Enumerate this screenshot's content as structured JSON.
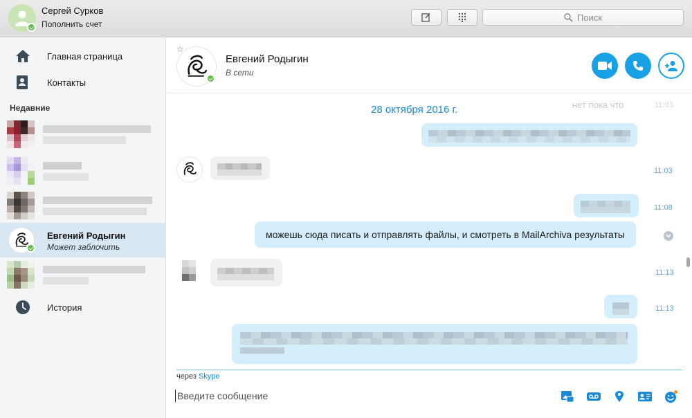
{
  "window": {
    "user_name": "Сергей Сурков",
    "user_action": "Пополнить счет"
  },
  "toolbar": {
    "search_placeholder": "Поиск"
  },
  "sidebar": {
    "nav": [
      {
        "label": "Главная страница",
        "icon": "home-icon"
      },
      {
        "label": "Контакты",
        "icon": "contacts-icon"
      }
    ],
    "recent_title": "Недавние",
    "active_contact": {
      "name": "Евгений Родыгин",
      "status": "Может заблочить"
    },
    "history_label": "История"
  },
  "conversation": {
    "contact_name": "Евгений Родыгин",
    "contact_status": "В сети",
    "date_header": "28 октября 2016 г.",
    "ghost_text": "нет пока что",
    "ghost_time": "11:03",
    "messages": [
      {
        "time": "11:03"
      },
      {
        "time": "11:08"
      },
      {
        "text": "можешь сюда писать и отправлять файлы, и смотреть в MailArchiva результаты"
      },
      {
        "time": "11:13"
      },
      {
        "time": "11:13"
      }
    ]
  },
  "composer": {
    "via_prefix": "через",
    "via_link": "Skype",
    "placeholder": "Введите сообщение"
  },
  "colors": {
    "accent": "#17a0e4",
    "online": "#5fba46",
    "bubble_out": "#d5eefb",
    "sidebar_active": "#d8e7f2"
  }
}
